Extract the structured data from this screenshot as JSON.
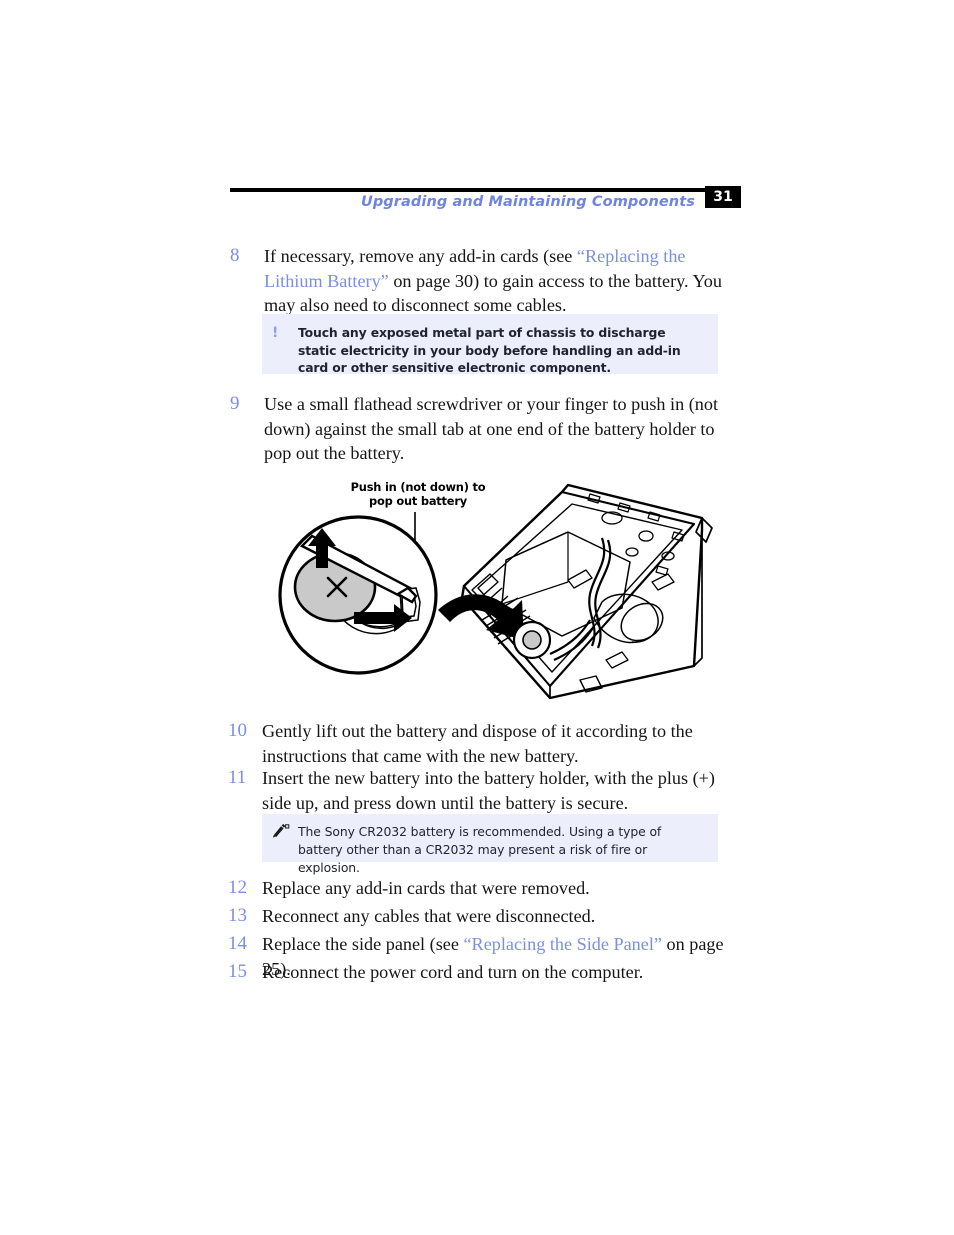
{
  "header": {
    "title": "Upgrading and Maintaining Components",
    "page_number": "31"
  },
  "steps": [
    {
      "number": "8",
      "text_parts": [
        {
          "t": "If necessary, remove any add-in cards (see ",
          "link": false
        },
        {
          "t": "“Replacing the Lithium Battery”",
          "link": true
        },
        {
          "t": " on page 30) to gain access to the battery. You may also need to disconnect some cables.",
          "link": false
        }
      ],
      "plain": "If necessary, remove any add-in cards (see “Replacing the Lithium Battery” on page 30) to gain access to the battery. You may also need to disconnect some cables."
    },
    {
      "number": "9",
      "plain": "Use a small flathead screwdriver or your finger to push in (not down) against the small tab at one end of the battery holder to pop out the battery."
    },
    {
      "number": "10",
      "plain": "Gently lift out the battery and dispose of it according to the instructions that came with the new battery."
    },
    {
      "number": "11",
      "plain": "Insert the new battery into the battery holder, with the plus (+) side up, and press down until the battery is secure."
    },
    {
      "number": "12",
      "plain": "Replace any add-in cards that were removed."
    },
    {
      "number": "13",
      "plain": "Reconnect any cables that were disconnected."
    },
    {
      "number": "14",
      "text_parts": [
        {
          "t": "Replace the side panel (see ",
          "link": false
        },
        {
          "t": "“Replacing the Side Panel”",
          "link": true
        },
        {
          "t": " on page 25).",
          "link": false
        }
      ],
      "plain": "Replace the side panel (see “Replacing the Side Panel” on page 25)."
    },
    {
      "number": "15",
      "plain": "Reconnect the power cord and turn on the computer."
    }
  ],
  "warning_box": {
    "icon": "exclamation-icon",
    "icon_glyph": "!",
    "text": "Touch any exposed metal part of chassis to discharge static electricity in your body before handling an add-in card or other sensitive electronic component."
  },
  "note_box": {
    "icon": "pencil-note-icon",
    "text": "The Sony CR2032 battery is recommended. Using a type of battery other than a CR2032 may present a risk of fire or explosion."
  },
  "figure": {
    "caption_line1": "Push in (not down) to",
    "caption_line2": "pop out battery",
    "caption": "Push in (not down) to pop out battery",
    "battery_plus_label": "+",
    "description": "Magnified view of coin cell battery in holder with screwdriver pushing tab, beside line drawing of open computer chassis"
  },
  "colors": {
    "accent_blue": "#7b8ee3",
    "header_blue": "#6f83e0",
    "callout_bg": "#eceffb",
    "badge_bg": "#000000",
    "text": "#161616",
    "battery_gray": "#c9c9c9"
  }
}
